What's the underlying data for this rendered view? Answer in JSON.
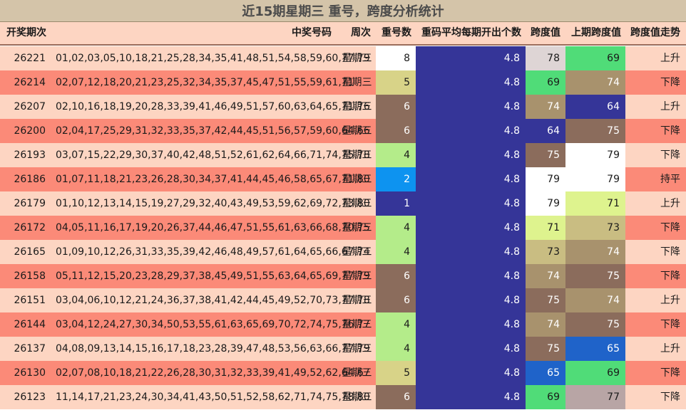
{
  "title": "近15期星期三 重号，跨度分析统计",
  "headers": {
    "period": "开奖期次",
    "numbers": "中奖号码",
    "weekday": "周次",
    "repeat": "重号数",
    "avg": "重码平均每期开出个数",
    "span": "跨度值",
    "prev_span": "上期跨度值",
    "trend": "跨度值走势"
  },
  "colors": {
    "row_light": "#fdd5c2",
    "row_dark": "#fb8a78",
    "avg_cell": "#353598",
    "header_bg": "#fdd5c2",
    "title_bg": "#d4c4a9"
  },
  "rows": [
    {
      "period": "26221",
      "numbers": "01,02,03,05,10,18,21,25,28,34,35,41,48,51,54,58,59,60,77,79",
      "weekday": "星期三",
      "repeat": "8",
      "avg": "4.8",
      "span": "78",
      "prev_span": "69",
      "trend": "上升",
      "repeat_color": "#ffffff",
      "span_color": "#ded5d5",
      "prev_color": "#50dc78"
    },
    {
      "period": "26214",
      "numbers": "02,07,12,18,20,21,23,25,32,34,35,37,45,47,51,55,59,61,71",
      "weekday": "星期三",
      "repeat": "5",
      "avg": "4.8",
      "span": "69",
      "prev_span": "74",
      "trend": "下降",
      "repeat_color": "#d8d388",
      "span_color": "#50dc78",
      "prev_color": "#a8926d"
    },
    {
      "period": "26207",
      "numbers": "02,10,16,18,19,20,28,33,39,41,46,49,51,57,60,63,64,65,71,76",
      "weekday": "星期三",
      "repeat": "6",
      "avg": "4.8",
      "span": "74",
      "prev_span": "64",
      "trend": "上升",
      "repeat_color": "#8b6c5c",
      "span_color": "#a8926d",
      "prev_color": "#353598"
    },
    {
      "period": "26200",
      "numbers": "02,04,17,25,29,31,32,33,35,37,42,44,45,51,56,57,59,60,64,66",
      "weekday": "星期三",
      "repeat": "6",
      "avg": "4.8",
      "span": "64",
      "prev_span": "75",
      "trend": "下降",
      "repeat_color": "#8b6c5c",
      "span_color": "#353598",
      "prev_color": "#8b6c5c"
    },
    {
      "period": "26193",
      "numbers": "03,07,15,22,29,30,37,40,42,48,51,52,61,62,64,66,71,74,75,78",
      "weekday": "星期三",
      "repeat": "4",
      "avg": "4.8",
      "span": "75",
      "prev_span": "79",
      "trend": "下降",
      "repeat_color": "#b4ec8a",
      "span_color": "#8b6c5c",
      "prev_color": "#ffffff"
    },
    {
      "period": "26186",
      "numbers": "01,07,11,18,21,23,26,28,30,34,37,41,44,45,46,58,65,67,71,80",
      "weekday": "星期三",
      "repeat": "2",
      "avg": "4.8",
      "span": "79",
      "prev_span": "79",
      "trend": "持平",
      "repeat_color": "#0d93f0",
      "span_color": "#ffffff",
      "prev_color": "#ffffff"
    },
    {
      "period": "26179",
      "numbers": "01,10,12,13,14,15,19,27,29,32,40,43,49,53,59,62,69,72,73,80",
      "weekday": "星期三",
      "repeat": "1",
      "avg": "4.8",
      "span": "79",
      "prev_span": "71",
      "trend": "上升",
      "repeat_color": "#353598",
      "span_color": "#ffffff",
      "prev_color": "#def38e"
    },
    {
      "period": "26172",
      "numbers": "04,05,11,16,17,19,20,26,37,44,46,47,51,55,61,63,66,68,70,75",
      "weekday": "星期三",
      "repeat": "4",
      "avg": "4.8",
      "span": "71",
      "prev_span": "73",
      "trend": "下降",
      "repeat_color": "#b4ec8a",
      "span_color": "#def38e",
      "prev_color": "#c9bd82"
    },
    {
      "period": "26165",
      "numbers": "01,09,10,12,26,31,33,35,39,42,46,48,49,57,61,64,65,66,67,74",
      "weekday": "星期三",
      "repeat": "4",
      "avg": "4.8",
      "span": "73",
      "prev_span": "74",
      "trend": "下降",
      "repeat_color": "#b4ec8a",
      "span_color": "#c9bd82",
      "prev_color": "#a8926d"
    },
    {
      "period": "26158",
      "numbers": "05,11,12,15,20,23,28,29,37,38,45,49,51,55,63,64,65,69,77,79",
      "weekday": "星期三",
      "repeat": "6",
      "avg": "4.8",
      "span": "74",
      "prev_span": "75",
      "trend": "下降",
      "repeat_color": "#8b6c5c",
      "span_color": "#a8926d",
      "prev_color": "#8b6c5c"
    },
    {
      "period": "26151",
      "numbers": "03,04,06,10,12,21,24,36,37,38,41,42,44,45,49,52,70,73,77,78",
      "weekday": "星期三",
      "repeat": "6",
      "avg": "4.8",
      "span": "75",
      "prev_span": "74",
      "trend": "上升",
      "repeat_color": "#8b6c5c",
      "span_color": "#8b6c5c",
      "prev_color": "#a8926d"
    },
    {
      "period": "26144",
      "numbers": "03,04,12,24,27,30,34,50,53,55,61,63,65,69,70,72,74,75,76,77",
      "weekday": "星期三",
      "repeat": "4",
      "avg": "4.8",
      "span": "74",
      "prev_span": "75",
      "trend": "下降",
      "repeat_color": "#b4ec8a",
      "span_color": "#a8926d",
      "prev_color": "#8b6c5c"
    },
    {
      "period": "26137",
      "numbers": "04,08,09,13,14,15,16,17,18,23,28,39,47,48,53,56,63,66,77,79",
      "weekday": "星期三",
      "repeat": "4",
      "avg": "4.8",
      "span": "75",
      "prev_span": "65",
      "trend": "上升",
      "repeat_color": "#b4ec8a",
      "span_color": "#8b6c5c",
      "prev_color": "#1f63c9"
    },
    {
      "period": "26130",
      "numbers": "02,07,08,10,18,21,22,26,28,30,31,32,33,39,41,49,52,62,64,67",
      "weekday": "星期三",
      "repeat": "5",
      "avg": "4.8",
      "span": "65",
      "prev_span": "69",
      "trend": "下降",
      "repeat_color": "#d8d388",
      "span_color": "#1f63c9",
      "prev_color": "#50dc78"
    },
    {
      "period": "26123",
      "numbers": "11,14,17,21,23,24,30,34,41,43,50,51,52,58,62,71,74,75,78,80",
      "weekday": "星期三",
      "repeat": "6",
      "avg": "4.8",
      "span": "69",
      "prev_span": "77",
      "trend": "下降",
      "repeat_color": "#8b6c5c",
      "span_color": "#50dc78",
      "prev_color": "#b8a5a5"
    }
  ]
}
